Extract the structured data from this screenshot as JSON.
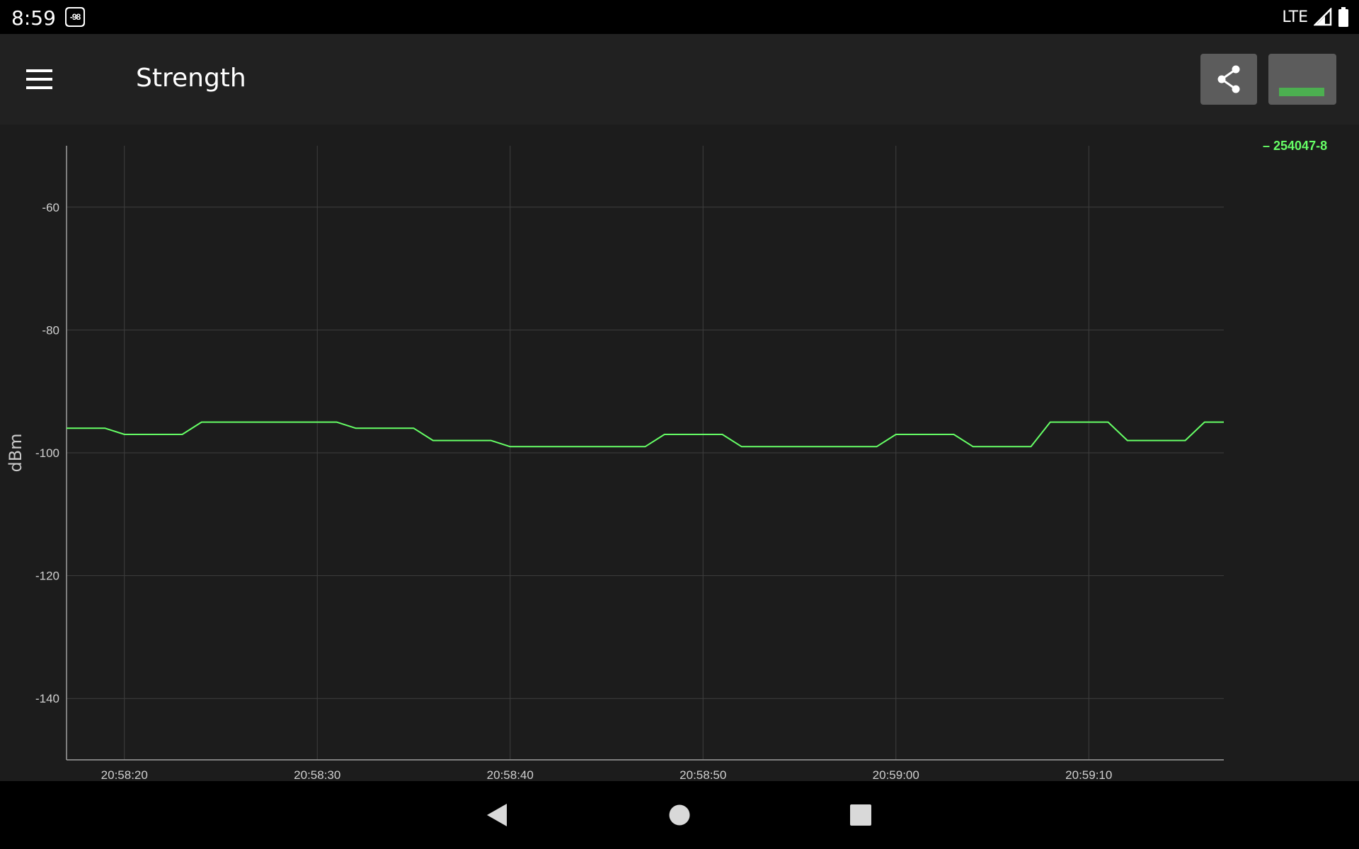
{
  "status_bar": {
    "time": "8:59",
    "signal_badge": "-98",
    "network": "LTE",
    "icons": [
      "signal-icon",
      "battery-icon"
    ]
  },
  "app_bar": {
    "title": "Strength",
    "menu_icon": "hamburger-menu-icon",
    "share_icon": "share-icon",
    "signal_button_icon": "signal-bar-icon",
    "accent": "#4caf50"
  },
  "chart_data": {
    "type": "line",
    "title": "",
    "xlabel": "",
    "ylabel": "dBm",
    "ylim": [
      -150,
      -50
    ],
    "yticks": [
      -60,
      -80,
      -100,
      -120,
      -140
    ],
    "xticks": [
      "20:58:20",
      "20:58:30",
      "20:58:40",
      "20:58:50",
      "20:59:00",
      "20:59:10"
    ],
    "x_range": [
      "20:58:17",
      "20:59:17"
    ],
    "grid": true,
    "legend_position": "top-right",
    "series": [
      {
        "name": "254047-8",
        "color": "#66ff66",
        "x": [
          "20:58:17",
          "20:58:18",
          "20:58:19",
          "20:58:20",
          "20:58:21",
          "20:58:22",
          "20:58:23",
          "20:58:24",
          "20:58:25",
          "20:58:26",
          "20:58:27",
          "20:58:28",
          "20:58:29",
          "20:58:30",
          "20:58:31",
          "20:58:32",
          "20:58:33",
          "20:58:34",
          "20:58:35",
          "20:58:36",
          "20:58:37",
          "20:58:38",
          "20:58:39",
          "20:58:40",
          "20:58:41",
          "20:58:42",
          "20:58:43",
          "20:58:44",
          "20:58:45",
          "20:58:46",
          "20:58:47",
          "20:58:48",
          "20:58:49",
          "20:58:50",
          "20:58:51",
          "20:58:52",
          "20:58:53",
          "20:58:54",
          "20:58:55",
          "20:58:56",
          "20:58:57",
          "20:58:58",
          "20:58:59",
          "20:59:00",
          "20:59:01",
          "20:59:02",
          "20:59:03",
          "20:59:04",
          "20:59:05",
          "20:59:06",
          "20:59:07",
          "20:59:08",
          "20:59:09",
          "20:59:10",
          "20:59:11",
          "20:59:12",
          "20:59:13",
          "20:59:14",
          "20:59:15",
          "20:59:16",
          "20:59:17"
        ],
        "values": [
          -96,
          -96,
          -96,
          -97,
          -97,
          -97,
          -97,
          -95,
          -95,
          -95,
          -95,
          -95,
          -95,
          -95,
          -95,
          -96,
          -96,
          -96,
          -96,
          -98,
          -98,
          -98,
          -98,
          -99,
          -99,
          -99,
          -99,
          -99,
          -99,
          -99,
          -99,
          -97,
          -97,
          -97,
          -97,
          -99,
          -99,
          -99,
          -99,
          -99,
          -99,
          -99,
          -99,
          -97,
          -97,
          -97,
          -97,
          -99,
          -99,
          -99,
          -99,
          -95,
          -95,
          -95,
          -95,
          -98,
          -98,
          -98,
          -98,
          -95,
          -95
        ]
      }
    ]
  },
  "nav_bar": {
    "back_icon": "back-triangle-icon",
    "home_icon": "home-circle-icon",
    "recents_icon": "recents-square-icon"
  }
}
